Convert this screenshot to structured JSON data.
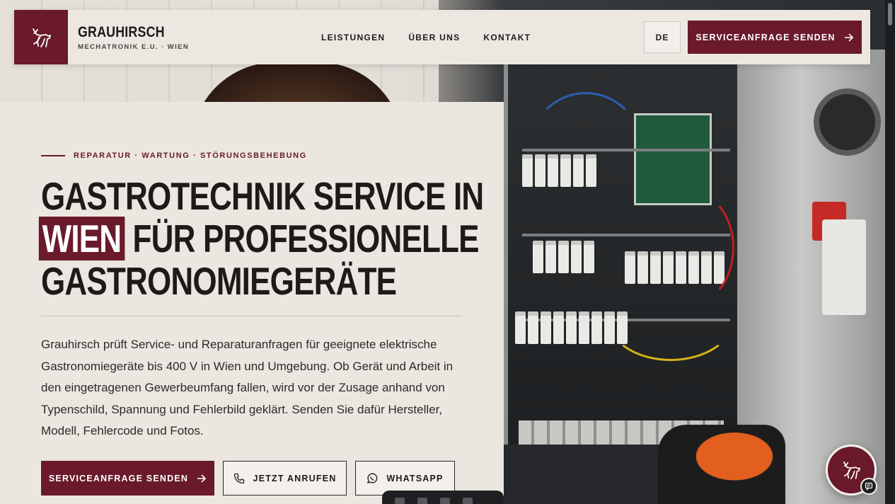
{
  "header": {
    "brand_name": "GRAUHIRSCH",
    "brand_sub": "MECHATRONIK E.U. · WIEN",
    "logo_icon": "deer-icon",
    "nav": [
      {
        "label": "LEISTUNGEN"
      },
      {
        "label": "ÜBER UNS"
      },
      {
        "label": "KONTAKT"
      }
    ],
    "language": "DE",
    "cta_label": "SERVICEANFRAGE SENDEN"
  },
  "hero": {
    "eyebrow": "REPARATUR · WARTUNG · STÖRUNGSBEHEBUNG",
    "headline_line1": "GASTROTECHNIK SERVICE IN",
    "headline_highlight": "WIEN",
    "headline_line2_rest": " FÜR PROFESSIONELLE",
    "headline_line3": "GASTRONOMIEGERÄTE",
    "description": "Grauhirsch prüft Service- und Reparaturanfragen für geeignete elektrische Gastronomiegeräte bis 400 V in Wien und Umgebung. Ob Gerät und Arbeit in den eingetragenen Gewerbeumfang fallen, wird vor der Zusage anhand von Typenschild, Spannung und Fehlerbild geklärt. Senden Sie dafür Hersteller, Modell, Fehlercode und Fotos.",
    "buttons": {
      "primary": "SERVICEANFRAGE SENDEN",
      "call": "JETZT ANRUFEN",
      "whatsapp": "WHATSAPP"
    }
  },
  "colors": {
    "brand": "#6a1a2b",
    "background": "#ebe6e0",
    "text": "#1d1b19"
  }
}
